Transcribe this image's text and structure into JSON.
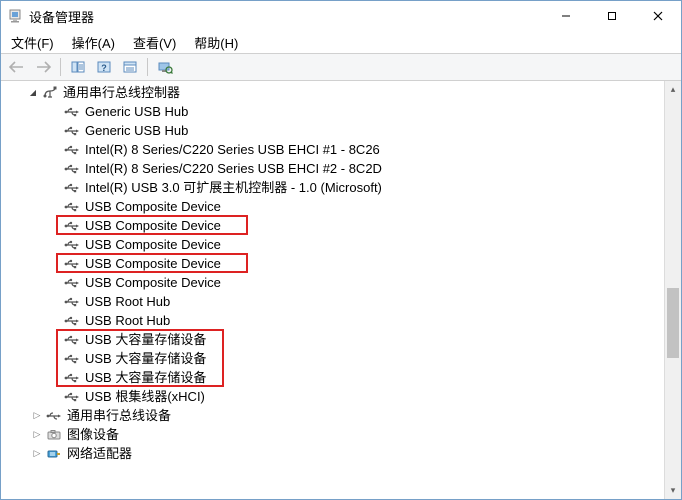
{
  "window": {
    "title": "设备管理器",
    "btn_min": "—",
    "btn_max": "☐",
    "btn_close": "✕"
  },
  "menu": {
    "file": "文件(F)",
    "action": "操作(A)",
    "view": "查看(V)",
    "help": "帮助(H)"
  },
  "tree": {
    "category_usb_controllers": "通用串行总线控制器",
    "usb_items": [
      "Generic USB Hub",
      "Generic USB Hub",
      "Intel(R) 8 Series/C220 Series USB EHCI #1 - 8C26",
      "Intel(R) 8 Series/C220 Series USB EHCI #2 - 8C2D",
      "Intel(R) USB 3.0 可扩展主机控制器 - 1.0 (Microsoft)",
      "USB Composite Device",
      "USB Composite Device",
      "USB Composite Device",
      "USB Composite Device",
      "USB Composite Device",
      "USB Root Hub",
      "USB Root Hub",
      "USB 大容量存储设备",
      "USB 大容量存储设备",
      "USB 大容量存储设备",
      "USB 根集线器(xHCI)"
    ],
    "category_usb_devices": "通用串行总线设备",
    "category_imaging": "图像设备",
    "category_network": "网络适配器"
  }
}
